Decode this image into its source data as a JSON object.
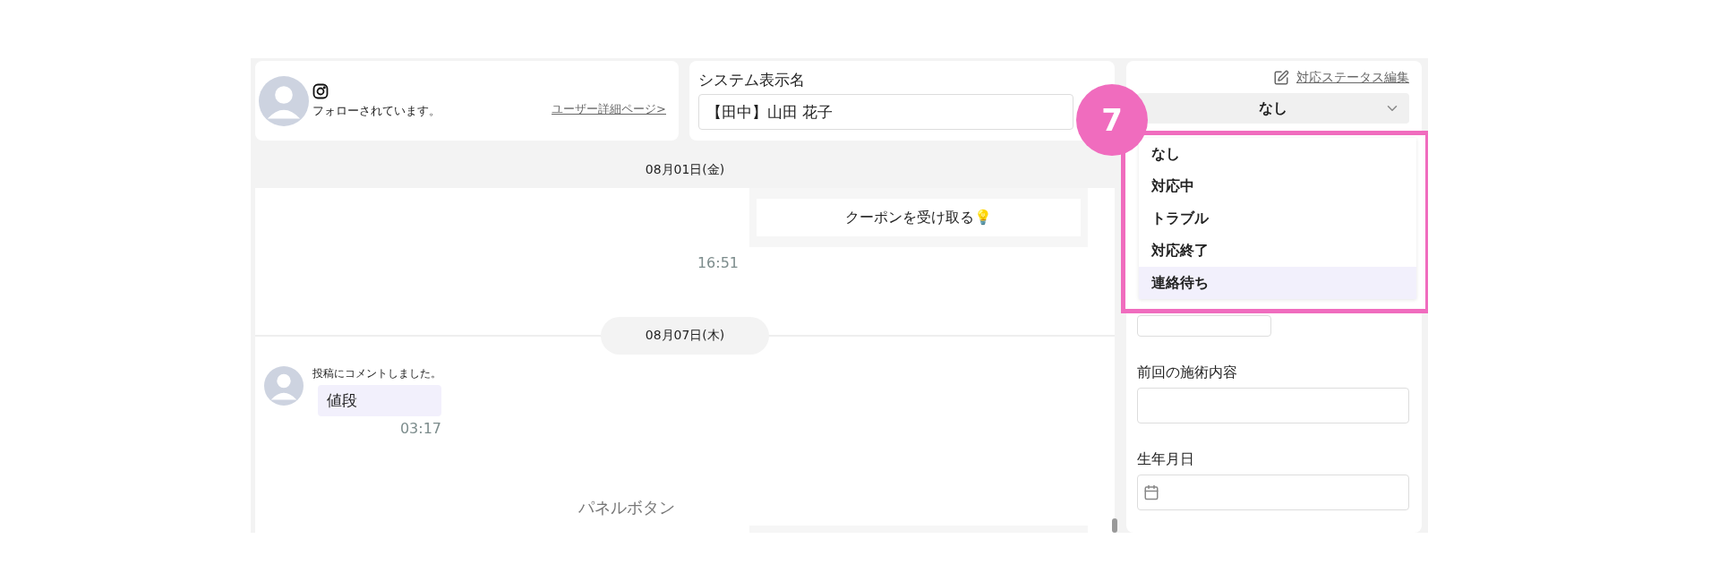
{
  "profile": {
    "follow_status": "フォローされています。",
    "detail_link": "ユーザー詳細ページ>"
  },
  "display_name": {
    "label": "システム表示名",
    "value": "【田中】山田 花子"
  },
  "chat": {
    "items": [
      {
        "kind": "date_bar",
        "text": "08月01日(金)"
      },
      {
        "kind": "outgoing",
        "text": "クーポンを受け取る💡",
        "time": "16:51"
      },
      {
        "kind": "date_pill",
        "text": "08月07日(木)"
      },
      {
        "kind": "comment",
        "note": "投稿にコメントしました。",
        "text": "値段",
        "time": "03:17"
      },
      {
        "kind": "panel",
        "text": "パネルボタン"
      }
    ]
  },
  "status": {
    "edit_link": "対応ステータス編集",
    "value": "なし",
    "options": [
      {
        "label": "なし",
        "highlighted": false
      },
      {
        "label": "対応中",
        "highlighted": false
      },
      {
        "label": "トラブル",
        "highlighted": false
      },
      {
        "label": "対応終了",
        "highlighted": false
      },
      {
        "label": "連絡待ち",
        "highlighted": true
      }
    ]
  },
  "annotation": {
    "number": "7"
  },
  "fields": [
    {
      "kind": "short"
    },
    {
      "kind": "text",
      "label": "前回の施術内容"
    },
    {
      "kind": "date",
      "label": "生年月日"
    }
  ]
}
